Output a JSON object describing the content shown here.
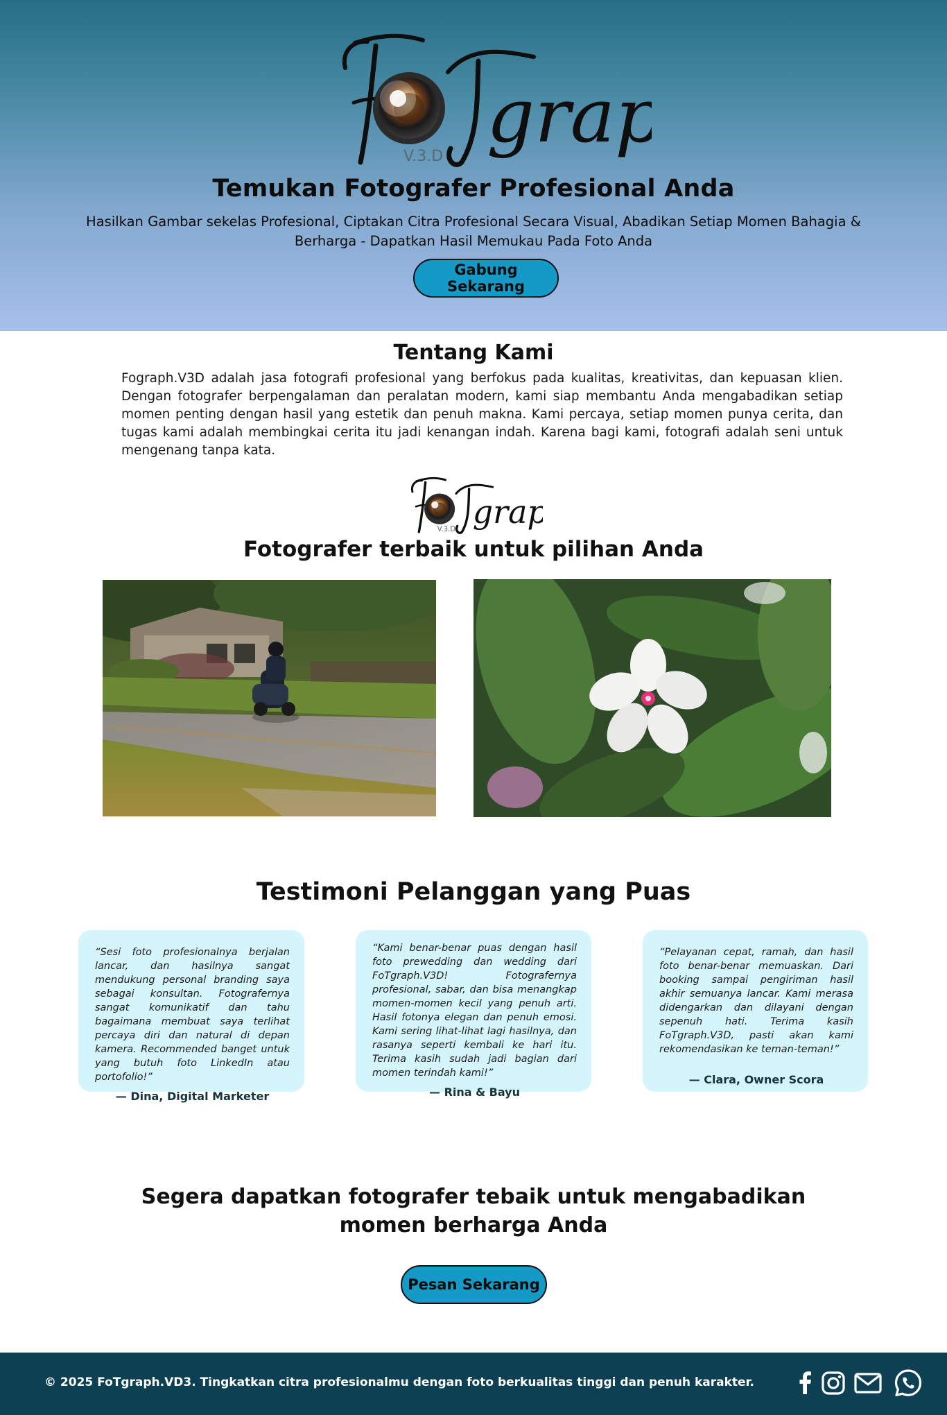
{
  "hero": {
    "logo_text": "FoTgraph",
    "logo_badge": "V.3.D",
    "title": "Temukan Fotografer Profesional Anda",
    "subtitle": "Hasilkan Gambar sekelas Profesional, Ciptakan Citra Profesional Secara Visual, Abadikan Setiap Momen Bahagia & Berharga - Dapatkan Hasil Memukau Pada Foto Anda",
    "button_label": "Gabung Sekarang"
  },
  "about": {
    "title": "Tentang Kami",
    "text": "Fograph.V3D adalah jasa fotografi profesional yang berfokus pada kualitas, kreativitas, dan kepuasan klien. Dengan fotografer berpengalaman dan peralatan modern, kami siap membantu Anda mengabadikan setiap momen penting dengan hasil yang estetik dan penuh makna. Kami percaya, setiap momen punya cerita, dan tugas kami adalah membingkai cerita itu jadi kenangan indah. Karena bagi kami, fotografi adalah seni untuk mengenang tanpa kata."
  },
  "portfolio": {
    "logo_text": "FoTgraph",
    "logo_badge": "V.3.D",
    "title": "Fotografer terbaik untuk pilihan Anda"
  },
  "testimonials": {
    "title": "Testimoni Pelanggan yang Puas",
    "items": [
      {
        "quote": "“Sesi foto profesionalnya berjalan lancar, dan hasilnya sangat mendukung personal branding saya sebagai konsultan. Fotografernya sangat komunikatif dan tahu bagaimana membuat saya terlihat percaya diri dan natural di depan kamera. Recommended banget untuk yang butuh foto LinkedIn atau portofolio!”",
        "author": "— Dina, Digital Marketer"
      },
      {
        "quote": "“Kami benar-benar puas dengan hasil foto prewedding dan wedding dari FoTgraph.V3D! Fotografernya profesional, sabar, dan bisa menangkap momen-momen kecil yang penuh arti. Hasil fotonya elegan dan penuh emosi. Kami sering lihat-lihat lagi hasilnya, dan rasanya seperti kembali ke hari itu. Terima kasih sudah jadi bagian dari momen terindah kami!”",
        "author": "— Rina & Bayu"
      },
      {
        "quote": "“Pelayanan cepat, ramah, dan hasil foto benar-benar memuaskan. Dari booking sampai pengiriman hasil akhir semuanya lancar. Kami merasa didengarkan dan dilayani dengan sepenuh hati. Terima kasih FoTgraph.V3D, pasti akan kami rekomendasikan ke teman-teman!”",
        "author": "— Clara, Owner Scora"
      }
    ]
  },
  "cta": {
    "title_line1": "Segera dapatkan fotografer tebaik untuk mengabadikan",
    "title_line2": "momen berharga Anda",
    "button_label": "Pesan Sekarang"
  },
  "footer": {
    "text": "© 2025 FoTgraph.VD3. Tingkatkan citra profesionalmu dengan foto berkualitas tinggi dan penuh karakter.",
    "social_icons": [
      "facebook-icon",
      "instagram-icon",
      "email-icon",
      "whatsapp-icon"
    ]
  },
  "colors": {
    "hero_top": "#266e85",
    "hero_bottom": "#a6c0ec",
    "button_bg": "#1599c6",
    "card_bg": "#d5f5fd",
    "footer_bg": "#0c4052"
  }
}
